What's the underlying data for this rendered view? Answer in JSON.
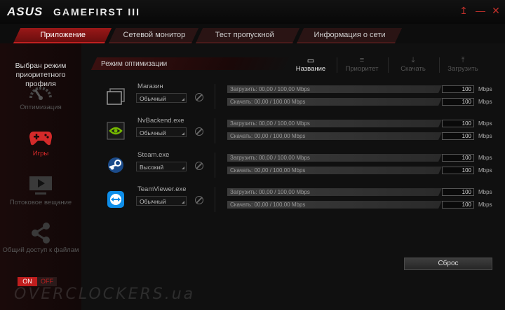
{
  "titlebar": {
    "brand": "ASUS",
    "app_name": "GAMEFIRST III",
    "up_icon": "↥",
    "minimize_icon": "—",
    "close_icon": "✕"
  },
  "tabs": [
    "Приложение",
    "Сетевой монитор",
    "Тест пропускной способности",
    "Информация о сети"
  ],
  "sidebar": {
    "header": "Выбран режим приоритетного профиля",
    "items": [
      {
        "label": "Оптимизация",
        "icon": "speedometer-icon"
      },
      {
        "label": "Игры",
        "icon": "gamepad-icon",
        "active": true
      },
      {
        "label": "Потоковое вещание",
        "icon": "video-play-icon"
      },
      {
        "label": "Общий доступ к файлам",
        "icon": "share-icon"
      }
    ],
    "toggle": {
      "on": "ON",
      "off": "OFF"
    }
  },
  "main": {
    "mode_label": "Режим оптимизации",
    "sort": [
      "Название",
      "Приоритет",
      "Скачать",
      "Загрузить"
    ],
    "apps": [
      {
        "name": "Магазин",
        "priority": "Обычный",
        "upload": "Загрузить: 00,00 / 100,00 Mbps",
        "download": "Скачать: 00,00 / 100,00 Mbps",
        "up_limit": "100",
        "down_limit": "100",
        "unit": "Mbps"
      },
      {
        "name": "NvBackend.exe",
        "priority": "Обычный",
        "upload": "Загрузить: 00,00 / 100,00 Mbps",
        "download": "Скачать: 00,00 / 100,00 Mbps",
        "up_limit": "100",
        "down_limit": "100",
        "unit": "Mbps"
      },
      {
        "name": "Steam.exe",
        "priority": "Высокий",
        "upload": "Загрузить: 00,00 / 100,00 Mbps",
        "download": "Скачать: 00,00 / 100,00 Mbps",
        "up_limit": "100",
        "down_limit": "100",
        "unit": "Mbps"
      },
      {
        "name": "TeamViewer.exe",
        "priority": "Обычный",
        "upload": "Загрузить: 00,00 / 100,00 Mbps",
        "download": "Скачать: 00,00 / 100,00 Mbps",
        "up_limit": "100",
        "down_limit": "100",
        "unit": "Mbps"
      }
    ],
    "reset_label": "Сброс"
  },
  "watermark": "OVERCLOCKERS.ua",
  "colors": {
    "accent": "#c01e1e",
    "background": "#0d0d0d"
  }
}
